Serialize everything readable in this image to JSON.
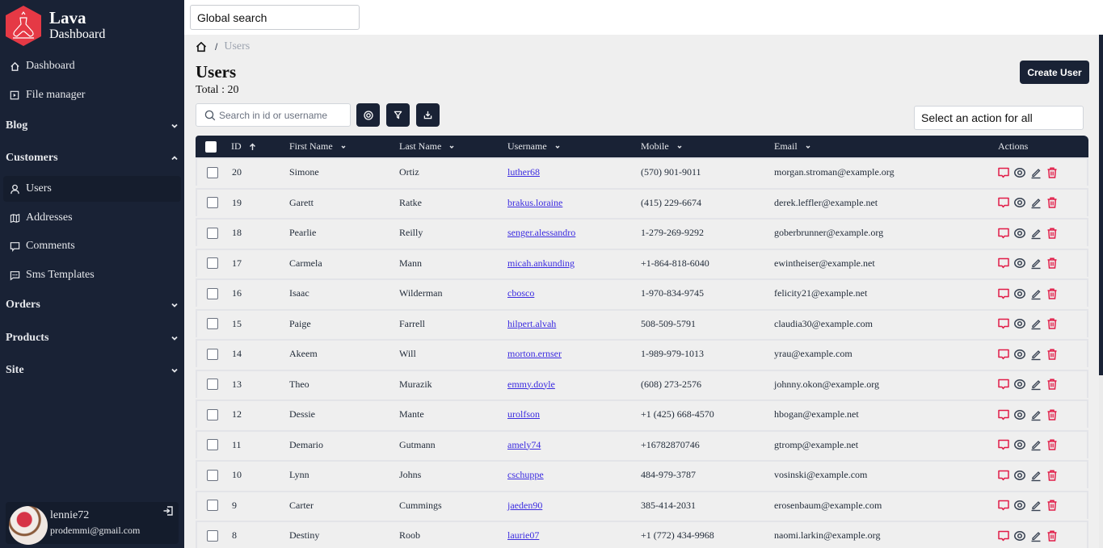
{
  "brand": {
    "title": "Lava",
    "subtitle": "Dashboard",
    "accent": "#e53945"
  },
  "sidebar": {
    "top_items": [
      {
        "label": "Dashboard",
        "icon": "home-icon"
      },
      {
        "label": "File manager",
        "icon": "file-icon"
      }
    ],
    "sections": [
      {
        "label": "Blog",
        "expanded": false
      },
      {
        "label": "Customers",
        "expanded": true,
        "items": [
          {
            "label": "Users",
            "icon": "user-icon",
            "active": true
          },
          {
            "label": "Addresses",
            "icon": "map-icon"
          },
          {
            "label": "Comments",
            "icon": "comment-icon"
          },
          {
            "label": "Sms Templates",
            "icon": "message-icon"
          }
        ]
      },
      {
        "label": "Orders",
        "expanded": false
      },
      {
        "label": "Products",
        "expanded": false
      },
      {
        "label": "Site",
        "expanded": false
      }
    ],
    "user": {
      "name": "lennie72",
      "email": "prodemmi@gmail.com"
    }
  },
  "topbar": {
    "global_search_placeholder": "Global search"
  },
  "breadcrumb": {
    "current": "Users",
    "separator": "/"
  },
  "page": {
    "title": "Users",
    "total": "Total : 20",
    "create_button": "Create User",
    "search_placeholder": "Search in id or username",
    "bulk_action_placeholder": "Select an action for all"
  },
  "table": {
    "columns": [
      "ID",
      "First Name",
      "Last Name",
      "Username",
      "Mobile",
      "Email",
      "Actions"
    ],
    "sort": {
      "column": "ID",
      "direction": "asc"
    },
    "rows": [
      {
        "id": "20",
        "first": "Simone",
        "last": "Ortiz",
        "username": "luther68",
        "mobile": "(570) 901-9011",
        "email": "morgan.stroman@example.org"
      },
      {
        "id": "19",
        "first": "Garett",
        "last": "Ratke",
        "username": "brakus.loraine",
        "mobile": "(415) 229-6674",
        "email": "derek.leffler@example.net"
      },
      {
        "id": "18",
        "first": "Pearlie",
        "last": "Reilly",
        "username": "senger.alessandro",
        "mobile": "1-279-269-9292",
        "email": "goberbrunner@example.org"
      },
      {
        "id": "17",
        "first": "Carmela",
        "last": "Mann",
        "username": "micah.ankunding",
        "mobile": "+1-864-818-6040",
        "email": "ewintheiser@example.net"
      },
      {
        "id": "16",
        "first": "Isaac",
        "last": "Wilderman",
        "username": "cbosco",
        "mobile": "1-970-834-9745",
        "email": "felicity21@example.net"
      },
      {
        "id": "15",
        "first": "Paige",
        "last": "Farrell",
        "username": "hilpert.alvah",
        "mobile": "508-509-5791",
        "email": "claudia30@example.com"
      },
      {
        "id": "14",
        "first": "Akeem",
        "last": "Will",
        "username": "morton.ernser",
        "mobile": "1-989-979-1013",
        "email": "yrau@example.com"
      },
      {
        "id": "13",
        "first": "Theo",
        "last": "Murazik",
        "username": "emmy.doyle",
        "mobile": "(608) 273-2576",
        "email": "johnny.okon@example.org"
      },
      {
        "id": "12",
        "first": "Dessie",
        "last": "Mante",
        "username": "urolfson",
        "mobile": "+1 (425) 668-4570",
        "email": "hbogan@example.net"
      },
      {
        "id": "11",
        "first": "Demario",
        "last": "Gutmann",
        "username": "amely74",
        "mobile": "+16782870746",
        "email": "gtromp@example.net"
      },
      {
        "id": "10",
        "first": "Lynn",
        "last": "Johns",
        "username": "cschuppe",
        "mobile": "484-979-3787",
        "email": "vosinski@example.com"
      },
      {
        "id": "9",
        "first": "Carter",
        "last": "Cummings",
        "username": "jaeden90",
        "mobile": "385-414-2031",
        "email": "erosenbaum@example.com"
      },
      {
        "id": "8",
        "first": "Destiny",
        "last": "Roob",
        "username": "laurie07",
        "mobile": "+1 (772) 434-9968",
        "email": "naomi.larkin@example.org"
      }
    ],
    "row_actions": [
      "comment-icon",
      "view-icon",
      "edit-icon",
      "delete-icon"
    ]
  },
  "colors": {
    "sidebar_bg": "#192235",
    "danger": "#e11d48",
    "link": "#3b2be0"
  }
}
